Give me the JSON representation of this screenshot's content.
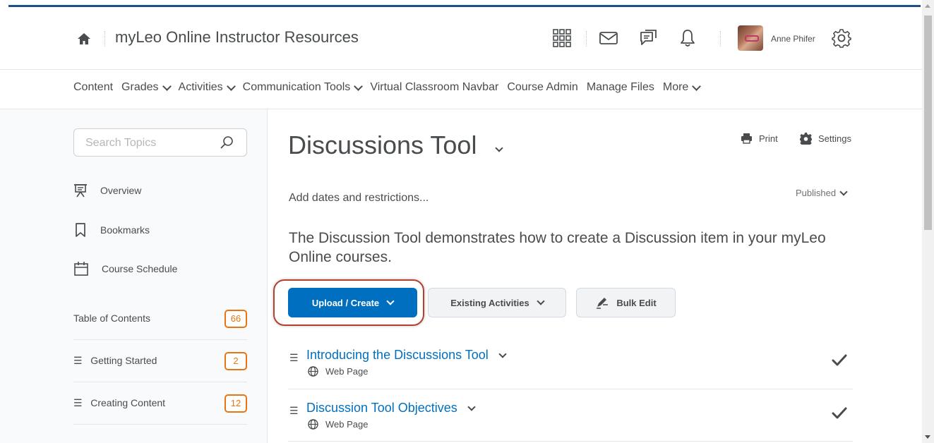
{
  "header": {
    "org_title": "myLeo Online Instructor Resources",
    "user_name": "Anne Phifer",
    "icons": [
      "home-icon",
      "waffle-grid-icon",
      "mail-icon",
      "chat-icon",
      "bell-icon",
      "gear-icon"
    ]
  },
  "navbar": {
    "items": [
      {
        "label": "Content",
        "dropdown": false
      },
      {
        "label": "Grades",
        "dropdown": true
      },
      {
        "label": "Activities",
        "dropdown": true
      },
      {
        "label": "Communication Tools",
        "dropdown": true
      },
      {
        "label": "Virtual Classroom Navbar",
        "dropdown": false
      },
      {
        "label": "Course Admin",
        "dropdown": false
      },
      {
        "label": "Manage Files",
        "dropdown": false
      },
      {
        "label": "More",
        "dropdown": true
      }
    ]
  },
  "sidebar": {
    "search_placeholder": "Search Topics",
    "links": [
      {
        "label": "Overview",
        "icon": "overview-icon"
      },
      {
        "label": "Bookmarks",
        "icon": "bookmark-icon"
      },
      {
        "label": "Course Schedule",
        "icon": "calendar-icon"
      }
    ],
    "toc": {
      "label": "Table of Contents",
      "count": "66"
    },
    "modules": [
      {
        "label": "Getting Started",
        "count": "2"
      },
      {
        "label": "Creating Content",
        "count": "12"
      }
    ]
  },
  "main": {
    "title": "Discussions Tool",
    "print_label": "Print",
    "settings_label": "Settings",
    "dates_label": "Add dates and restrictions...",
    "status_label": "Published",
    "description": "The Discussion Tool demonstrates how to create a Discussion item in your myLeo Online courses.",
    "buttons": {
      "upload_create": "Upload / Create",
      "existing_activities": "Existing Activities",
      "bulk_edit": "Bulk Edit"
    },
    "items": [
      {
        "title": "Introducing the Discussions Tool",
        "type": "Web Page",
        "completed": true
      },
      {
        "title": "Discussion Tool Objectives",
        "type": "Web Page",
        "completed": true
      }
    ]
  },
  "colors": {
    "accent": "#006fbf",
    "badge": "#e87511",
    "highlight_ring": "#b2412f",
    "top_bar": "#1f4f86"
  }
}
